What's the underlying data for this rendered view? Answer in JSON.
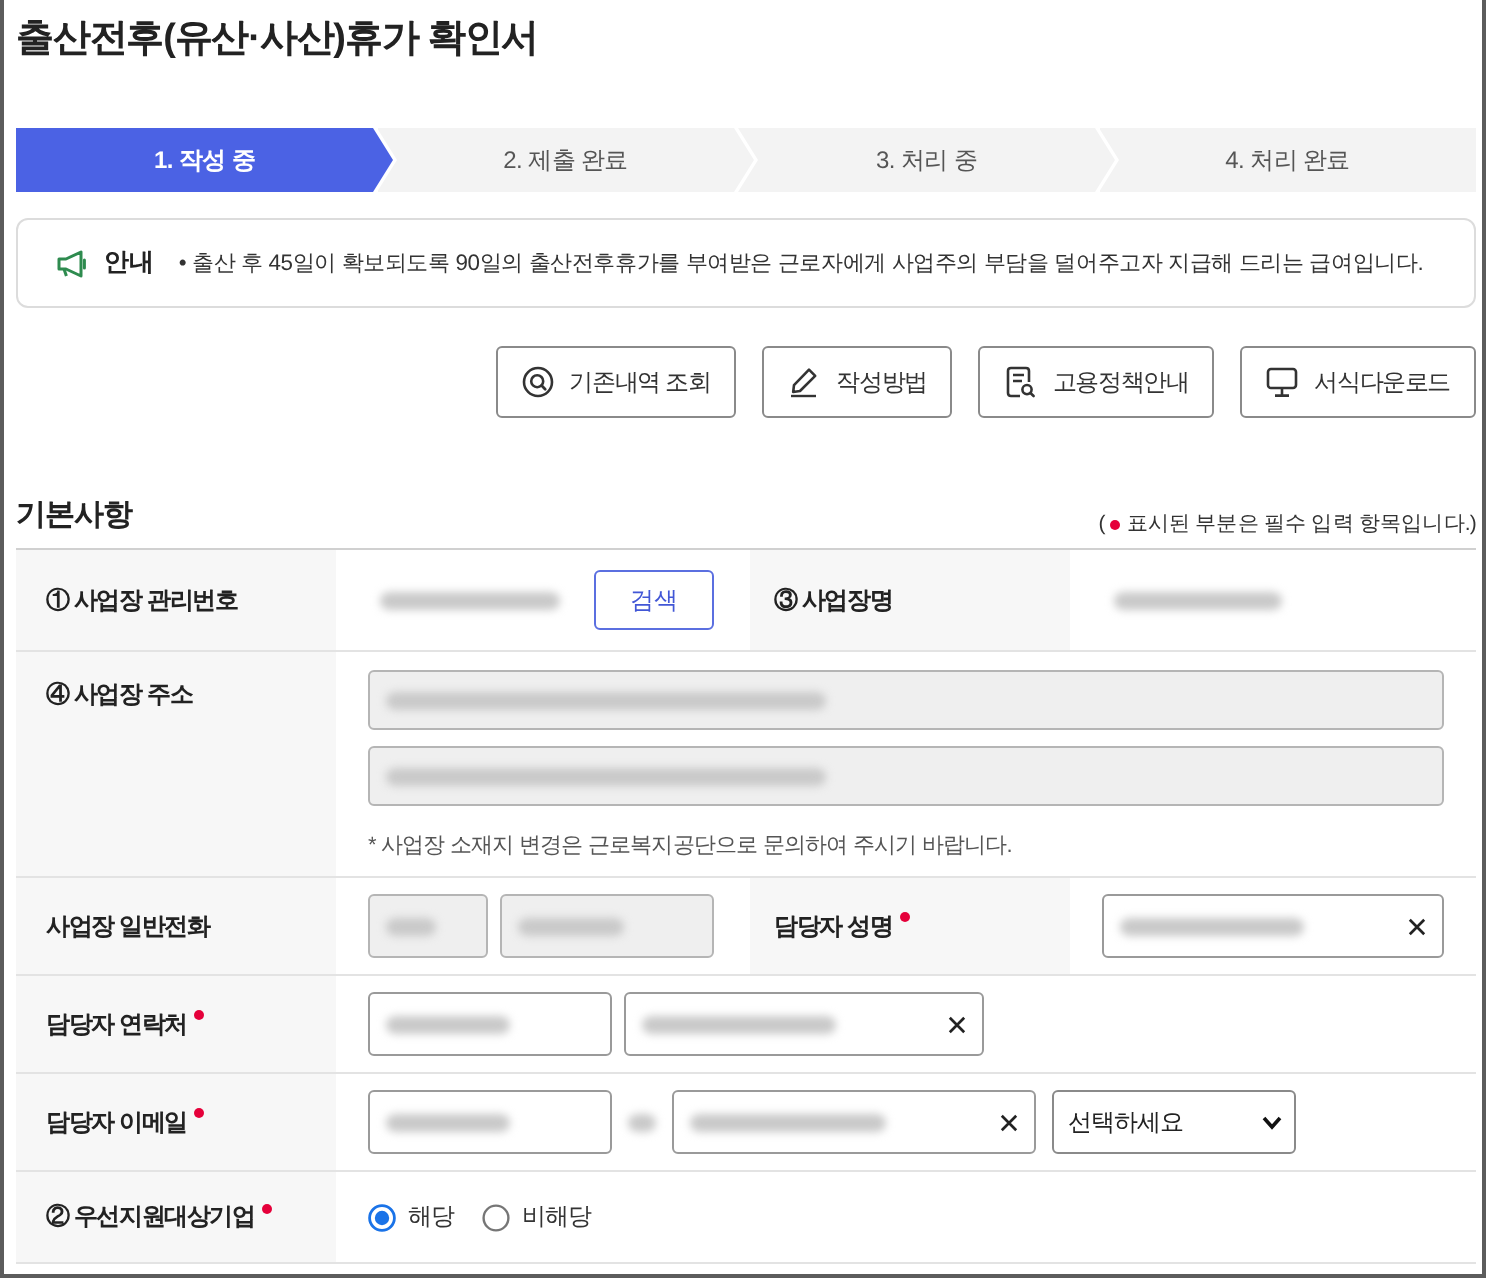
{
  "page": {
    "title": "출산전후(유산·사산)휴가 확인서"
  },
  "steps": [
    {
      "label": "1. 작성 중",
      "current": true
    },
    {
      "label": "2. 제출 완료",
      "current": false
    },
    {
      "label": "3. 처리 중",
      "current": false
    },
    {
      "label": "4. 처리 완료",
      "current": false
    }
  ],
  "notice": {
    "label": "안내",
    "text": "• 출산 후 45일이 확보되도록 90일의 출산전후휴가를 부여받은 근로자에게 사업주의 부담을 덜어주고자 지급해 드리는 급여입니다."
  },
  "actions": [
    {
      "label": "기존내역 조회"
    },
    {
      "label": "작성방법"
    },
    {
      "label": "고용정책안내"
    },
    {
      "label": "서식다운로드"
    }
  ],
  "basic_info": {
    "heading": "기본사항",
    "required_note": {
      "open": "(",
      "text": "표시된 부분은 필수 입력 항목입니다.)"
    },
    "rows": [
      {
        "kind": "lookup",
        "cells": [
          {
            "kind": "label",
            "text": "① 사업장 관리번호",
            "required": false
          },
          {
            "kind": "value",
            "items": [
              {
                "kind": "text",
                "redacted": true
              },
              {
                "kind": "button",
                "label": "검색"
              }
            ]
          },
          {
            "kind": "label",
            "text": "③ 사업장명",
            "required": false
          },
          {
            "kind": "value",
            "items": [
              {
                "kind": "text",
                "redacted": true
              }
            ]
          }
        ]
      },
      {
        "kind": "address",
        "cells": [
          {
            "kind": "label",
            "text": "④ 사업장 주소",
            "required": false
          },
          {
            "kind": "value",
            "items": [
              {
                "kind": "input",
                "disabled": true,
                "redacted": true,
                "clearable": false
              },
              {
                "kind": "input",
                "disabled": true,
                "redacted": true,
                "clearable": false
              },
              {
                "kind": "hint",
                "text": "* 사업장 소재지 변경은 근로복지공단으로 문의하여 주시기 바랍니다."
              }
            ]
          }
        ]
      },
      {
        "kind": "phone",
        "cells": [
          {
            "kind": "label",
            "text": "사업장 일반전화",
            "required": false
          },
          {
            "kind": "value",
            "items": [
              {
                "kind": "input",
                "disabled": true,
                "redacted": true,
                "clearable": false
              },
              {
                "kind": "input",
                "disabled": true,
                "redacted": true,
                "clearable": false
              }
            ]
          },
          {
            "kind": "label",
            "text": "담당자 성명",
            "required": true
          },
          {
            "kind": "value",
            "items": [
              {
                "kind": "input",
                "disabled": false,
                "redacted": true,
                "clearable": true
              }
            ]
          }
        ]
      },
      {
        "kind": "contact",
        "cells": [
          {
            "kind": "label",
            "text": "담당자 연락처",
            "required": true
          },
          {
            "kind": "value",
            "items": [
              {
                "kind": "input",
                "disabled": false,
                "redacted": true,
                "clearable": false
              },
              {
                "kind": "input",
                "disabled": false,
                "redacted": true,
                "clearable": true
              }
            ]
          }
        ]
      },
      {
        "kind": "email",
        "cells": [
          {
            "kind": "label",
            "text": "담당자 이메일",
            "required": true
          },
          {
            "kind": "value",
            "items": [
              {
                "kind": "input",
                "disabled": false,
                "redacted": true,
                "clearable": false
              },
              {
                "kind": "text",
                "redacted": true
              },
              {
                "kind": "input",
                "disabled": false,
                "redacted": true,
                "clearable": true
              },
              {
                "kind": "select",
                "value": "선택하세요"
              }
            ]
          }
        ]
      },
      {
        "kind": "choice",
        "cells": [
          {
            "kind": "label",
            "text": "② 우선지원대상기업",
            "required": true
          },
          {
            "kind": "value",
            "items": [
              {
                "kind": "radio",
                "label": "해당",
                "selected": true
              },
              {
                "kind": "radio",
                "label": "비해당",
                "selected": false
              }
            ]
          }
        ]
      }
    ]
  }
}
